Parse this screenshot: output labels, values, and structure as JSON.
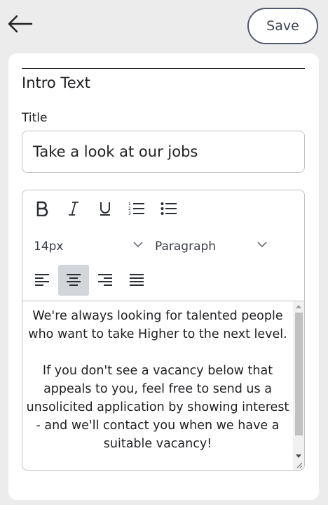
{
  "header": {
    "back_icon": "arrow-left-icon",
    "save_label": "Save"
  },
  "section": {
    "title": "Intro Text"
  },
  "title_field": {
    "label": "Title",
    "value": "Take a look at our jobs"
  },
  "editor": {
    "toolbar": {
      "buttons": [
        "bold-icon",
        "italic-icon",
        "underline-icon",
        "ordered-list-icon",
        "bullet-list-icon"
      ],
      "font_size": "14px",
      "block_format": "Paragraph",
      "alignments": [
        "align-left-icon",
        "align-center-icon",
        "align-right-icon",
        "align-justify-icon"
      ],
      "active_alignment": "center"
    },
    "content": {
      "paragraph1": "We're always looking for talented people who want to take Higher to the next level.",
      "paragraph2": "If you don't see a vacancy below that appeals to you, feel free to send us a unsolicited application by showing interest - and we'll contact you when we have a suitable vacancy!"
    }
  },
  "colors": {
    "background": "#ececed",
    "button_border": "#525a6c",
    "active_tool": "#d2d5da"
  }
}
